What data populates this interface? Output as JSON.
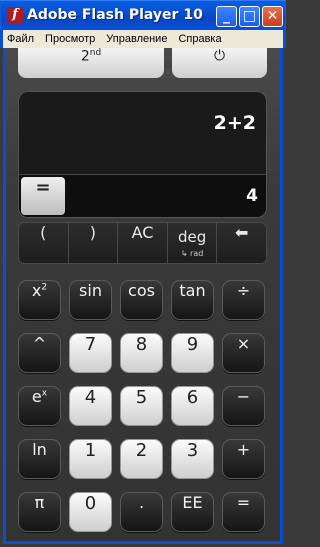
{
  "window": {
    "title": "Adobe Flash Player 10",
    "minimize_glyph": "_",
    "maximize_glyph": "□",
    "close_glyph": "✕"
  },
  "menu": [
    "Файл",
    "Просмотр",
    "Управление",
    "Справка"
  ],
  "top_buttons": {
    "second": "2",
    "second_sup": "nd",
    "power": "⏻"
  },
  "display": {
    "expression": "2+2",
    "equals": "=",
    "result": "4"
  },
  "function_row": {
    "lparen": "(",
    "rparen": ")",
    "ac": "AC",
    "deg": "deg",
    "deg_sub": "↳ rad",
    "backspace": "⬅"
  },
  "keypad": {
    "x2": "x",
    "x2_sup": "2",
    "sin": "sin",
    "cos": "cos",
    "tan": "tan",
    "divide": "÷",
    "power": "^",
    "seven": "7",
    "eight": "8",
    "nine": "9",
    "multiply": "×",
    "ex": "e",
    "ex_sup": "x",
    "four": "4",
    "five": "5",
    "six": "6",
    "minus": "−",
    "ln": "ln",
    "one": "1",
    "two": "2",
    "three": "3",
    "plus": "+",
    "pi": "π",
    "zero": "0",
    "dot": ".",
    "ee": "EE",
    "equals": "="
  }
}
